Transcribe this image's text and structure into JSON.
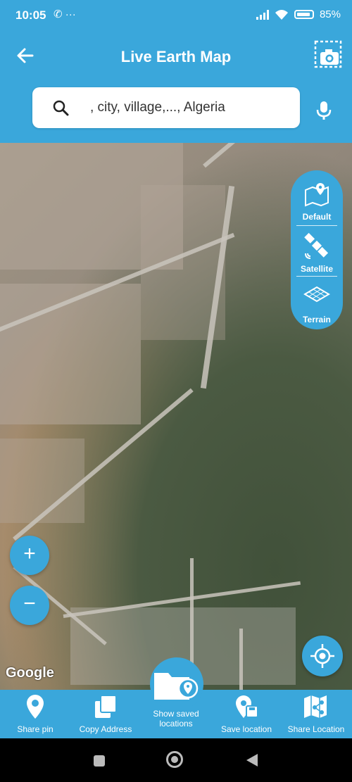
{
  "status_bar": {
    "time": "10:05",
    "left_icons": "✆ ···",
    "battery": "85%"
  },
  "header": {
    "title": "Live Earth Map",
    "back_icon": "back-arrow-icon",
    "screenshot_icon": "camera-capture-icon"
  },
  "search": {
    "placeholder": ", city, village,..., Algeria",
    "value": "",
    "mic_icon": "microphone-icon"
  },
  "map": {
    "attribution": "Google",
    "current_view": "Satellite"
  },
  "map_types": [
    {
      "label": "Default",
      "icon": "map-pin-icon"
    },
    {
      "label": "Satellite",
      "icon": "satellite-icon"
    },
    {
      "label": "Terrain",
      "icon": "terrain-icon"
    }
  ],
  "zoom": {
    "in": "+",
    "out": "−"
  },
  "bottom_nav": {
    "share_pin": "Share pin",
    "copy_address": "Copy Address",
    "show_saved": "Show saved locations",
    "save_location": "Save location",
    "share_location": "Share Location"
  },
  "colors": {
    "primary": "#3aa7db",
    "on_primary": "#ffffff"
  }
}
